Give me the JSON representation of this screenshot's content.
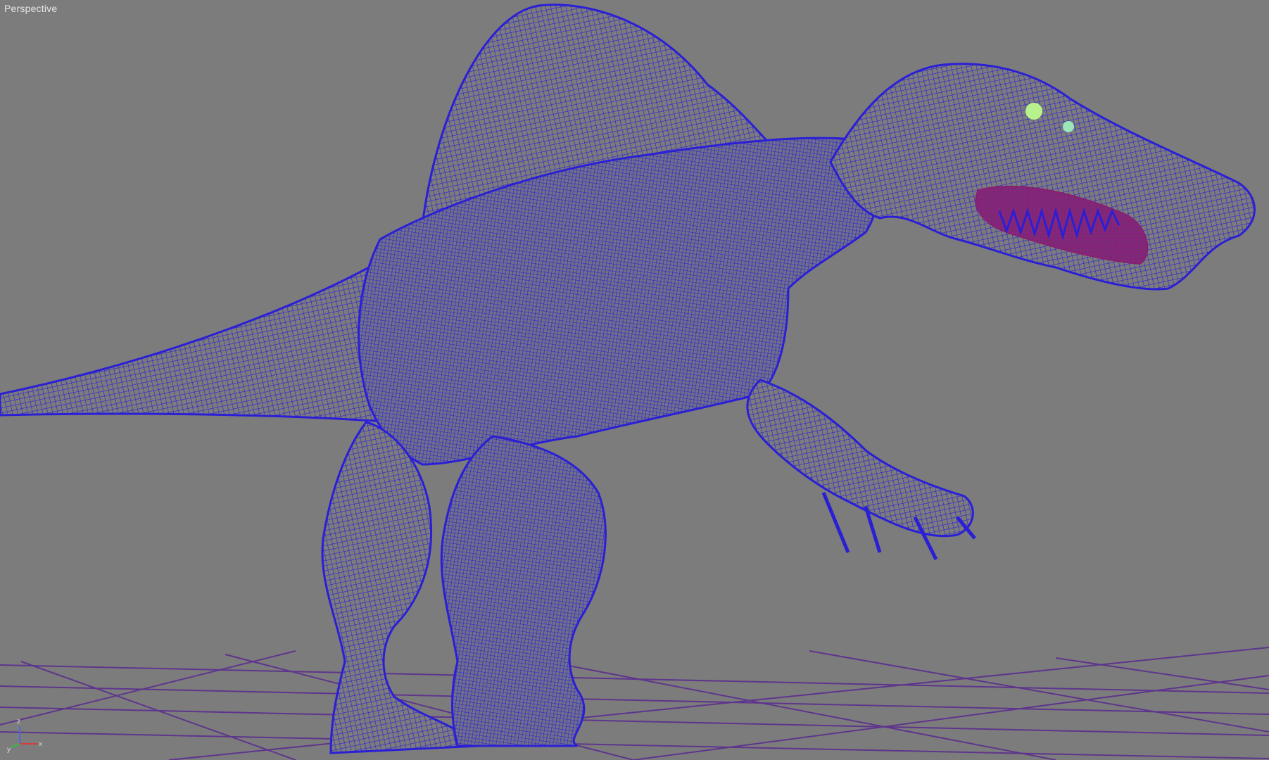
{
  "viewport": {
    "label": "Perspective",
    "background": "#7c7c7c"
  },
  "scene": {
    "model": "wireframe-dinosaur",
    "wire_color": "#2b1fd6",
    "mouth_color": "#8a1f6e",
    "eye_color": "#b8f28c",
    "grid_color": "#5b2e8e"
  },
  "axis": {
    "x_label": "x",
    "y_label": "y",
    "z_label": "z",
    "x_color": "#d63a3a",
    "y_color": "#2fbf3a",
    "z_color": "#4d6ad6"
  }
}
